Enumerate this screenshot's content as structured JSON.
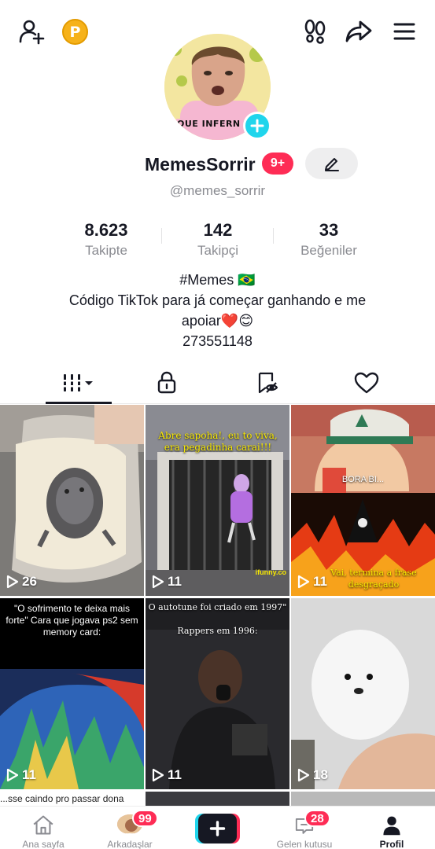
{
  "profile": {
    "username": "MemesSorrir",
    "notification_badge": "9+",
    "handle": "@memes_sorrir",
    "avatar_caption": "QUE INFERN",
    "coin_letter": "P"
  },
  "stats": [
    {
      "value": "8.623",
      "label": "Takipte"
    },
    {
      "value": "142",
      "label": "Takipçi"
    },
    {
      "value": "33",
      "label": "Beğeniler"
    }
  ],
  "bio": {
    "line1": "#Memes 🇧🇷",
    "line2": "Código TikTok para já começar ganhando e me",
    "line3": "apoiar❤️😊",
    "line4": "273551148"
  },
  "tabs": [
    "videos-grid",
    "private-lock",
    "reposts",
    "liked"
  ],
  "videos": [
    {
      "views": "26",
      "caption": ""
    },
    {
      "views": "11",
      "caption": "Abre sapoha!, eu to viva, era pegadinha carai!!!",
      "watermark": "ifunny.co"
    },
    {
      "views": "11",
      "caption_top": "BORA BI...",
      "caption": "Vai, termina a frase desgraçado"
    },
    {
      "views": "11",
      "caption": "\"O sofrimento te deixa mais forte\" Cara que jogava ps2 sem memory card:"
    },
    {
      "views": "11",
      "caption": "O autotune foi criado em 1997\"",
      "caption2": "Rappers em 1996:"
    },
    {
      "views": "18",
      "caption": ""
    }
  ],
  "partial_row_text": "...sse caindo pro passar dona",
  "bottom_nav": {
    "home": "Ana sayfa",
    "friends": "Arkadaşlar",
    "friends_badge": "99",
    "inbox": "Gelen kutusu",
    "inbox_badge": "28",
    "profile": "Profil"
  },
  "colors": {
    "accent": "#fe2c55",
    "cyan": "#20d5ec",
    "coin": "#f6b21a"
  }
}
